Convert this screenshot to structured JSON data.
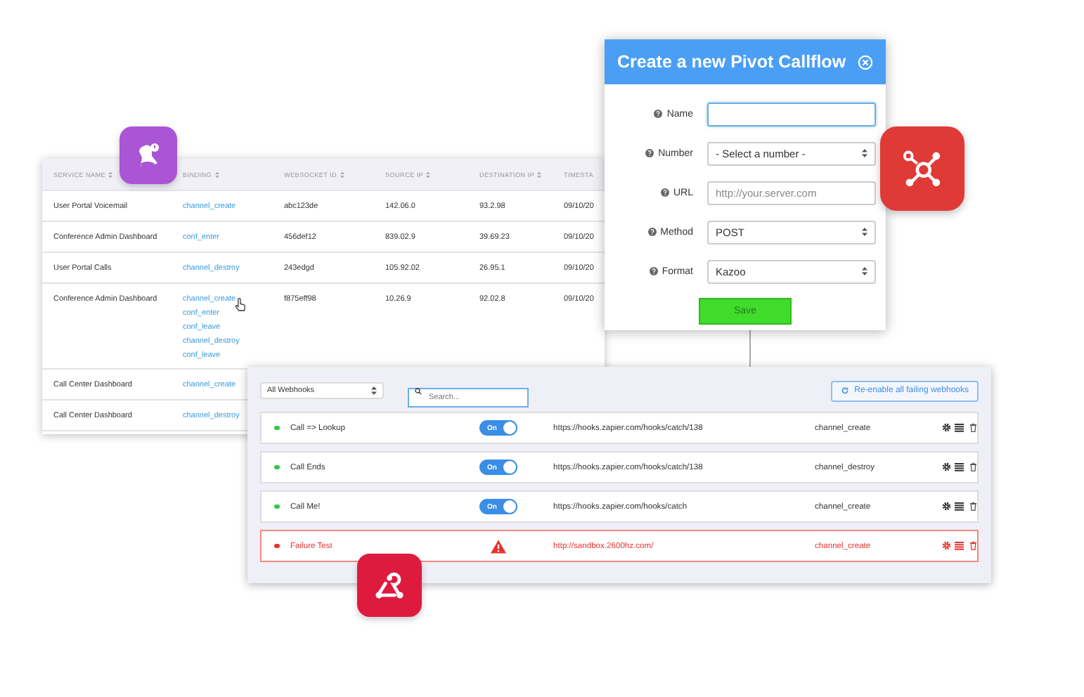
{
  "sessions_table": {
    "columns": [
      "SERVICE NAME",
      "BINDING",
      "WEBSOCKET ID",
      "SOURCE IP",
      "DESTINATION IP",
      "TIMESTA"
    ],
    "rows": [
      {
        "service": "User Portal Voicemail",
        "bindings": [
          "channel_create"
        ],
        "websocket_id": "abc123de",
        "source_ip": "142.06.0",
        "destination_ip": "93.2.98",
        "timestamp": "09/10/20",
        "pointer": false
      },
      {
        "service": "Conference Admin Dashboard",
        "bindings": [
          "conf_enter"
        ],
        "websocket_id": "456def12",
        "source_ip": "839.02.9",
        "destination_ip": "39.69.23",
        "timestamp": "09/10/20",
        "pointer": false
      },
      {
        "service": "User Portal Calls",
        "bindings": [
          "channel_destroy"
        ],
        "websocket_id": "243edgd",
        "source_ip": "105.92.02",
        "destination_ip": "26.95.1",
        "timestamp": "09/10/20",
        "pointer": false
      },
      {
        "service": "Conference Admin Dashboard",
        "bindings": [
          "channel_create",
          "conf_enter",
          "conf_leave",
          "channel_destroy",
          "conf_leave"
        ],
        "websocket_id": "f875eff98",
        "source_ip": "10.26.9",
        "destination_ip": "92.02.8",
        "timestamp": "09/10/20",
        "pointer": true
      },
      {
        "service": "Call Center Dashboard",
        "bindings": [
          "channel_create"
        ],
        "pointer": false
      },
      {
        "service": "Call Center Dashboard",
        "bindings": [
          "channel_destroy"
        ],
        "pointer": false
      }
    ]
  },
  "dialog": {
    "title": "Create a new Pivot Callflow",
    "fields": [
      {
        "label": "Name",
        "kind": "text",
        "focused": true
      },
      {
        "label": "Number",
        "kind": "select",
        "value": "- Select a number -"
      },
      {
        "label": "URL",
        "kind": "text",
        "placeholder": "http://your.server.com",
        "focused": false
      },
      {
        "label": "Method",
        "kind": "select",
        "value": "POST"
      },
      {
        "label": "Format",
        "kind": "select",
        "value": "Kazoo"
      }
    ],
    "save_button": "Save"
  },
  "webhooks": {
    "filter": "All Webhooks",
    "search_placeholder": "Search...",
    "reenable_button": "Re-enable all failing webhooks",
    "rows": [
      {
        "name": "Call => Lookup",
        "kind": "toggle",
        "on": true,
        "toggle_label": "On",
        "url": "https://hooks.zapier.com/hooks/catch/138",
        "event": "channel_create",
        "failing": false,
        "color": "#2ecc40"
      },
      {
        "name": "Call Ends",
        "kind": "toggle",
        "on": true,
        "toggle_label": "On",
        "url": "https://hooks.zapier.com/hooks/catch/138",
        "event": "channel_destroy",
        "failing": false,
        "color": "#2ecc40"
      },
      {
        "name": "Call Me!",
        "kind": "toggle",
        "on": true,
        "toggle_label": "On",
        "url": "https://hooks.zapier.com/hooks/catch",
        "event": "channel_create",
        "failing": false,
        "color": "#2ecc40"
      },
      {
        "name": "Failure Test",
        "kind": "warning",
        "url": "http://sandbox.2600hz.com/",
        "event": "channel_create",
        "failing": true,
        "color": "#e8322f"
      }
    ]
  }
}
